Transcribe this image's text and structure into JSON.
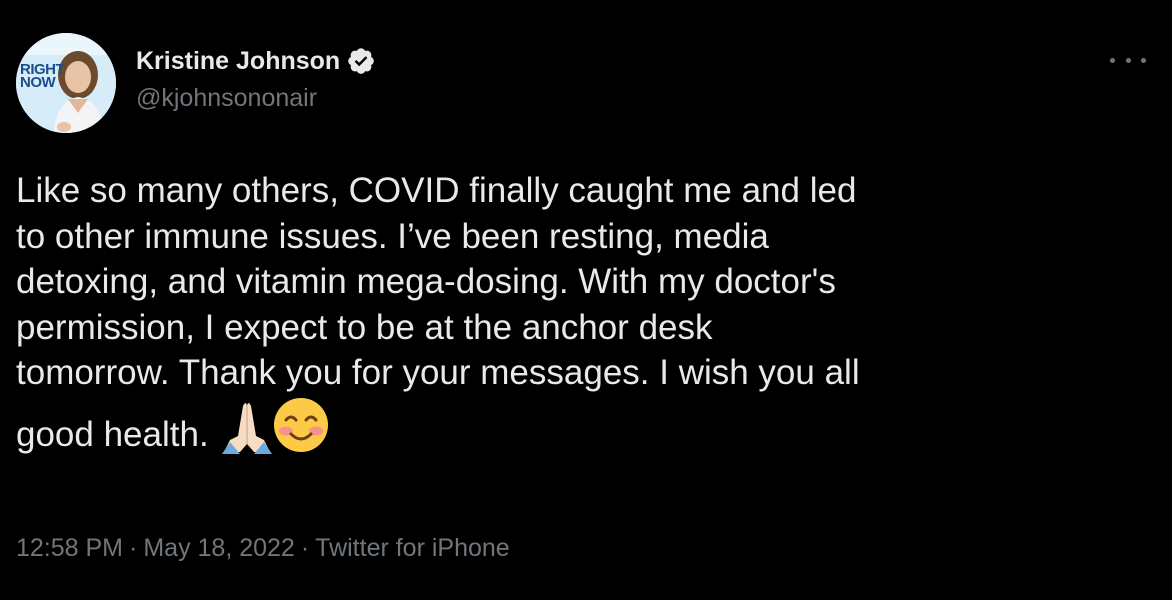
{
  "user": {
    "display_name": "Kristine Johnson",
    "handle": "@kjohnsononair",
    "verified": true,
    "avatar_logo_line1": "RIGHT",
    "avatar_logo_line2": "NOW"
  },
  "tweet": {
    "lines": [
      "Like so many others, COVID finally caught me and led",
      "to other immune issues. I’ve been resting, media",
      "detoxing, and vitamin mega-dosing. With my doctor's",
      "permission, I expect to be at the anchor desk",
      "tomorrow. Thank you for your messages. I wish you all",
      "good health."
    ],
    "emojis": [
      "folded-hands-icon",
      "smiling-face-icon"
    ]
  },
  "meta": {
    "time": "12:58 PM",
    "separator": "·",
    "date": "May 18, 2022",
    "source": "Twitter for iPhone"
  },
  "colors": {
    "background": "#000000",
    "text": "#e7e9ea",
    "muted": "#71767b"
  }
}
